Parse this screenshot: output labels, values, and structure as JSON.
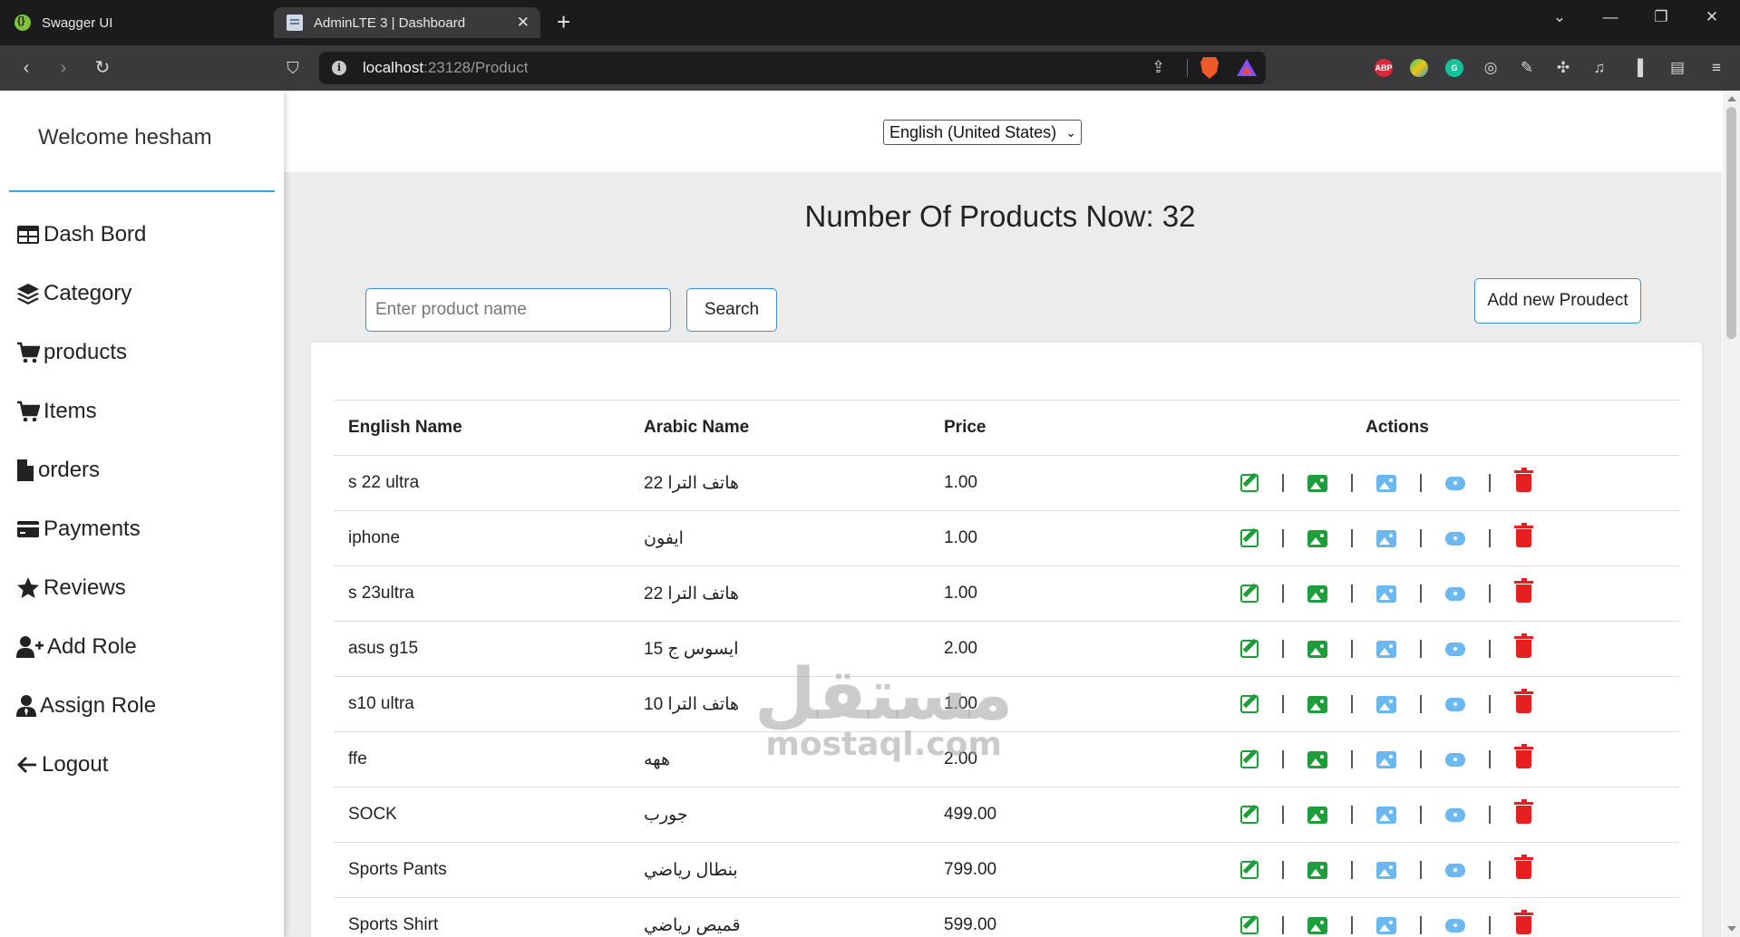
{
  "browser": {
    "tabs": [
      {
        "title": "Swagger UI",
        "active": false
      },
      {
        "title": "AdminLTE 3 | Dashboard",
        "active": true
      }
    ],
    "url_host": "localhost",
    "url_path": ":23128/Product",
    "extensions": [
      "adblock-plus-icon",
      "colorful-extension-icon",
      "grammarly-icon",
      "glasses-icon",
      "eyedropper-icon",
      "puzzle-icon",
      "music-icon",
      "sidebar-icon",
      "wallet-icon",
      "menu-icon"
    ]
  },
  "sidebar": {
    "welcome": "Welcome hesham",
    "items": [
      {
        "label": "Dash Bord",
        "icon": "table-icon"
      },
      {
        "label": "Category",
        "icon": "layers-icon"
      },
      {
        "label": "products",
        "icon": "cart-icon"
      },
      {
        "label": "Items",
        "icon": "cart-icon"
      },
      {
        "label": "orders",
        "icon": "file-icon"
      },
      {
        "label": "Payments",
        "icon": "credit-card-icon"
      },
      {
        "label": "Reviews",
        "icon": "star-icon"
      },
      {
        "label": "Add Role",
        "icon": "user-plus-icon"
      },
      {
        "label": "Assign Role",
        "icon": "user-tie-icon"
      },
      {
        "label": "Logout",
        "icon": "arrow-left-icon"
      }
    ]
  },
  "language": {
    "selected": "English (United States)"
  },
  "main": {
    "count_label": "Number Of Products Now: 32",
    "search_placeholder": "Enter product name",
    "search_button": "Search",
    "add_button": "Add new Proudect"
  },
  "table": {
    "headers": [
      "English Name",
      "Arabic Name",
      "Price",
      "Actions"
    ],
    "rows": [
      {
        "english": "s 22 ultra",
        "arabic": "هاتف الترا 22",
        "price": "1.00"
      },
      {
        "english": "iphone",
        "arabic": "ايفون",
        "price": "1.00"
      },
      {
        "english": "s 23ultra",
        "arabic": "هاتف الترا 22",
        "price": "1.00"
      },
      {
        "english": "asus g15",
        "arabic": "ايسوس ج 15",
        "price": "2.00"
      },
      {
        "english": "s10 ultra",
        "arabic": "هاتف الترا 10",
        "price": "1.00"
      },
      {
        "english": "ffe",
        "arabic": "ههه",
        "price": "2.00"
      },
      {
        "english": "SOCK",
        "arabic": "جورب",
        "price": "499.00"
      },
      {
        "english": "Sports Pants",
        "arabic": "بنطال رياضي",
        "price": "799.00"
      },
      {
        "english": "Sports Shirt",
        "arabic": "قميص رياضي",
        "price": "599.00"
      }
    ],
    "action_icons": [
      "edit-icon",
      "image-icon",
      "image-icon",
      "eye-icon",
      "trash-icon"
    ]
  },
  "watermark": {
    "arabic": "مستقل",
    "latin": "mostaql.com"
  },
  "colors": {
    "accent": "#3a8fd6",
    "edit": "#1e9e3a",
    "view": "#6bb8f0",
    "delete": "#e62020",
    "divider": "#3ea6d6"
  }
}
